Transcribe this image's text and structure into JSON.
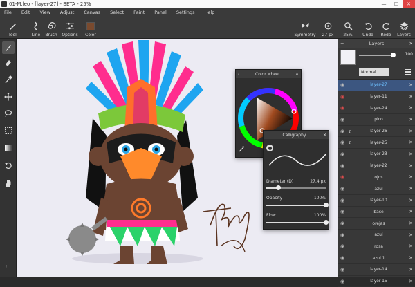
{
  "titlebar": {
    "title": "01-M.leo - [layer-27] - BETA - 25%",
    "minimize": "—",
    "maximize": "☐",
    "close": "✕"
  },
  "menu": [
    "File",
    "Edit",
    "View",
    "Adjust",
    "Canvas",
    "Select",
    "Paint",
    "Panel",
    "Settings",
    "Help"
  ],
  "toolbar": {
    "tool": "Tool",
    "line": "Line",
    "brush": "Brush",
    "options": "Options",
    "color": "Color",
    "symmetry": "Symmetry",
    "size": "27 px",
    "zoom": "25%",
    "undo": "Undo",
    "redo": "Redo",
    "layers": "Layers"
  },
  "colors": {
    "accent_select": "#3c5680",
    "brush_color": "#7a4a2e"
  },
  "layers_panel": {
    "title": "Layers",
    "add": "+",
    "close": "✕",
    "opacity": "100",
    "blend_mode": "Normal",
    "rows": [
      {
        "name": "layer-27",
        "eye": "visible",
        "lock": "",
        "selected": true,
        "blue": true
      },
      {
        "name": "layer-11",
        "eye": "hidden",
        "lock": ""
      },
      {
        "name": "layer-24",
        "eye": "hidden",
        "lock": ""
      },
      {
        "name": "pico",
        "eye": "visible",
        "lock": ""
      },
      {
        "name": "layer-26",
        "eye": "visible",
        "lock": "linked"
      },
      {
        "name": "layer-25",
        "eye": "visible",
        "lock": "linked"
      },
      {
        "name": "layer-23",
        "eye": "visible",
        "lock": ""
      },
      {
        "name": "layer-22",
        "eye": "visible",
        "lock": ""
      },
      {
        "name": "ojos",
        "eye": "hidden",
        "lock": ""
      },
      {
        "name": "azul",
        "eye": "visible",
        "lock": ""
      },
      {
        "name": "layer-10",
        "eye": "visible",
        "lock": ""
      },
      {
        "name": "base",
        "eye": "visible",
        "lock": ""
      },
      {
        "name": "orejas",
        "eye": "visible",
        "lock": ""
      },
      {
        "name": "azul",
        "eye": "visible",
        "lock": ""
      },
      {
        "name": "rosa",
        "eye": "visible",
        "lock": ""
      },
      {
        "name": "azul 1",
        "eye": "visible",
        "lock": ""
      },
      {
        "name": "layer-14",
        "eye": "visible",
        "lock": ""
      },
      {
        "name": "layer-15",
        "eye": "visible",
        "lock": ""
      }
    ]
  },
  "color_wheel": {
    "title": "Color wheel",
    "back": "‹",
    "close": "✕"
  },
  "brush_panel": {
    "title": "Calligraphy",
    "close": "✕",
    "diameter_label": "Diameter (D)",
    "diameter_value": "27.4 px",
    "diameter_level": 0.2,
    "opacity_label": "Opacity",
    "opacity_value": "100%",
    "opacity_level": 1,
    "flow_label": "Flow",
    "flow_value": "100%",
    "flow_level": 1
  },
  "signature_text": "Tonhy"
}
